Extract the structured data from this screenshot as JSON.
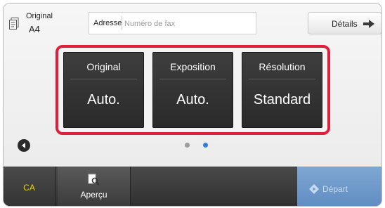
{
  "original_info": {
    "label": "Original",
    "size": "A4"
  },
  "address": {
    "label": "Adresse",
    "placeholder": "Numéro de fax"
  },
  "details_button": {
    "label": "Détails"
  },
  "keys": [
    {
      "title": "Original",
      "value": "Auto."
    },
    {
      "title": "Exposition",
      "value": "Auto."
    },
    {
      "title": "Résolution",
      "value": "Standard"
    }
  ],
  "pagination": {
    "pages": 2,
    "current": 2
  },
  "bottom_bar": {
    "ca_label": "CA",
    "preview_label": "Aperçu",
    "start_label": "Départ"
  },
  "colors": {
    "highlight_border": "#e0203a",
    "ca_text": "#f2d200",
    "start_button": "#6e98c9",
    "active_dot": "#2f7fd8",
    "inactive_dot": "#9a9a9a"
  },
  "icons": {
    "original": "document-stack-icon",
    "details": "arrow-right-icon",
    "prev": "chevron-left-icon",
    "preview": "magnifier-document-icon",
    "start": "diamond-start-icon"
  }
}
